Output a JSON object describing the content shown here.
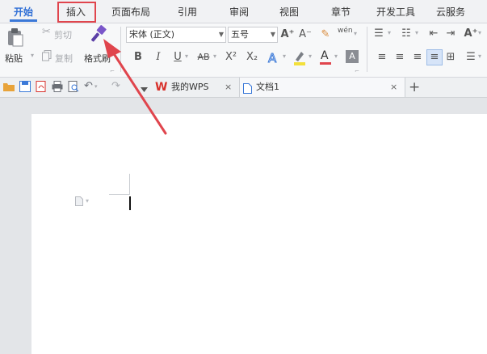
{
  "ribbon_tabs": [
    "开始",
    "插入",
    "页面布局",
    "引用",
    "审阅",
    "视图",
    "章节",
    "开发工具",
    "云服务"
  ],
  "clipboard": {
    "paste": "粘贴",
    "cut": "剪切",
    "copy": "复制",
    "format_painter": "格式刷"
  },
  "font": {
    "name": "宋体 (正文)",
    "size": "五号"
  },
  "format_buttons": {
    "bold": "B",
    "italic": "I",
    "underline": "U",
    "strikethrough": "AB",
    "superscript": "X²",
    "subscript": "X₂",
    "font_color": "A",
    "grow_font": "A⁺",
    "shrink_font": "A⁻",
    "wen": "wén"
  },
  "doc_tabs": [
    {
      "label": "我的WPS"
    },
    {
      "label": "文档1"
    }
  ],
  "colors": {
    "accent": "#3b79d8",
    "annotation": "#e0454d",
    "wps_red": "#d8322c"
  }
}
